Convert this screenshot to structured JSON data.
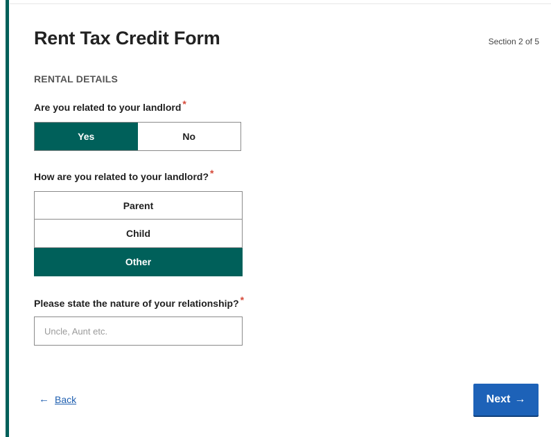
{
  "form": {
    "title": "Rent Tax Credit Form",
    "section_counter": "Section 2 of 5",
    "section_heading": "RENTAL DETAILS"
  },
  "questions": {
    "related": {
      "label": "Are you related to your landlord",
      "required_marker": "*",
      "options": [
        "Yes",
        "No"
      ],
      "selected": "Yes"
    },
    "relationship": {
      "label": "How are you related to your landlord?",
      "required_marker": "*",
      "options": [
        "Parent",
        "Child",
        "Other"
      ],
      "selected": "Other"
    },
    "nature": {
      "label": "Please state the nature of your relationship?",
      "required_marker": "*",
      "value": "",
      "placeholder": "Uncle, Aunt etc."
    }
  },
  "nav": {
    "back_label": "Back",
    "back_icon": "arrow-left-icon",
    "next_label": "Next",
    "next_icon": "arrow-right-icon"
  },
  "colors": {
    "accent": "#00605a",
    "primary_button": "#1d62b8",
    "required": "#d64a3a",
    "link": "#1f5fb0"
  }
}
